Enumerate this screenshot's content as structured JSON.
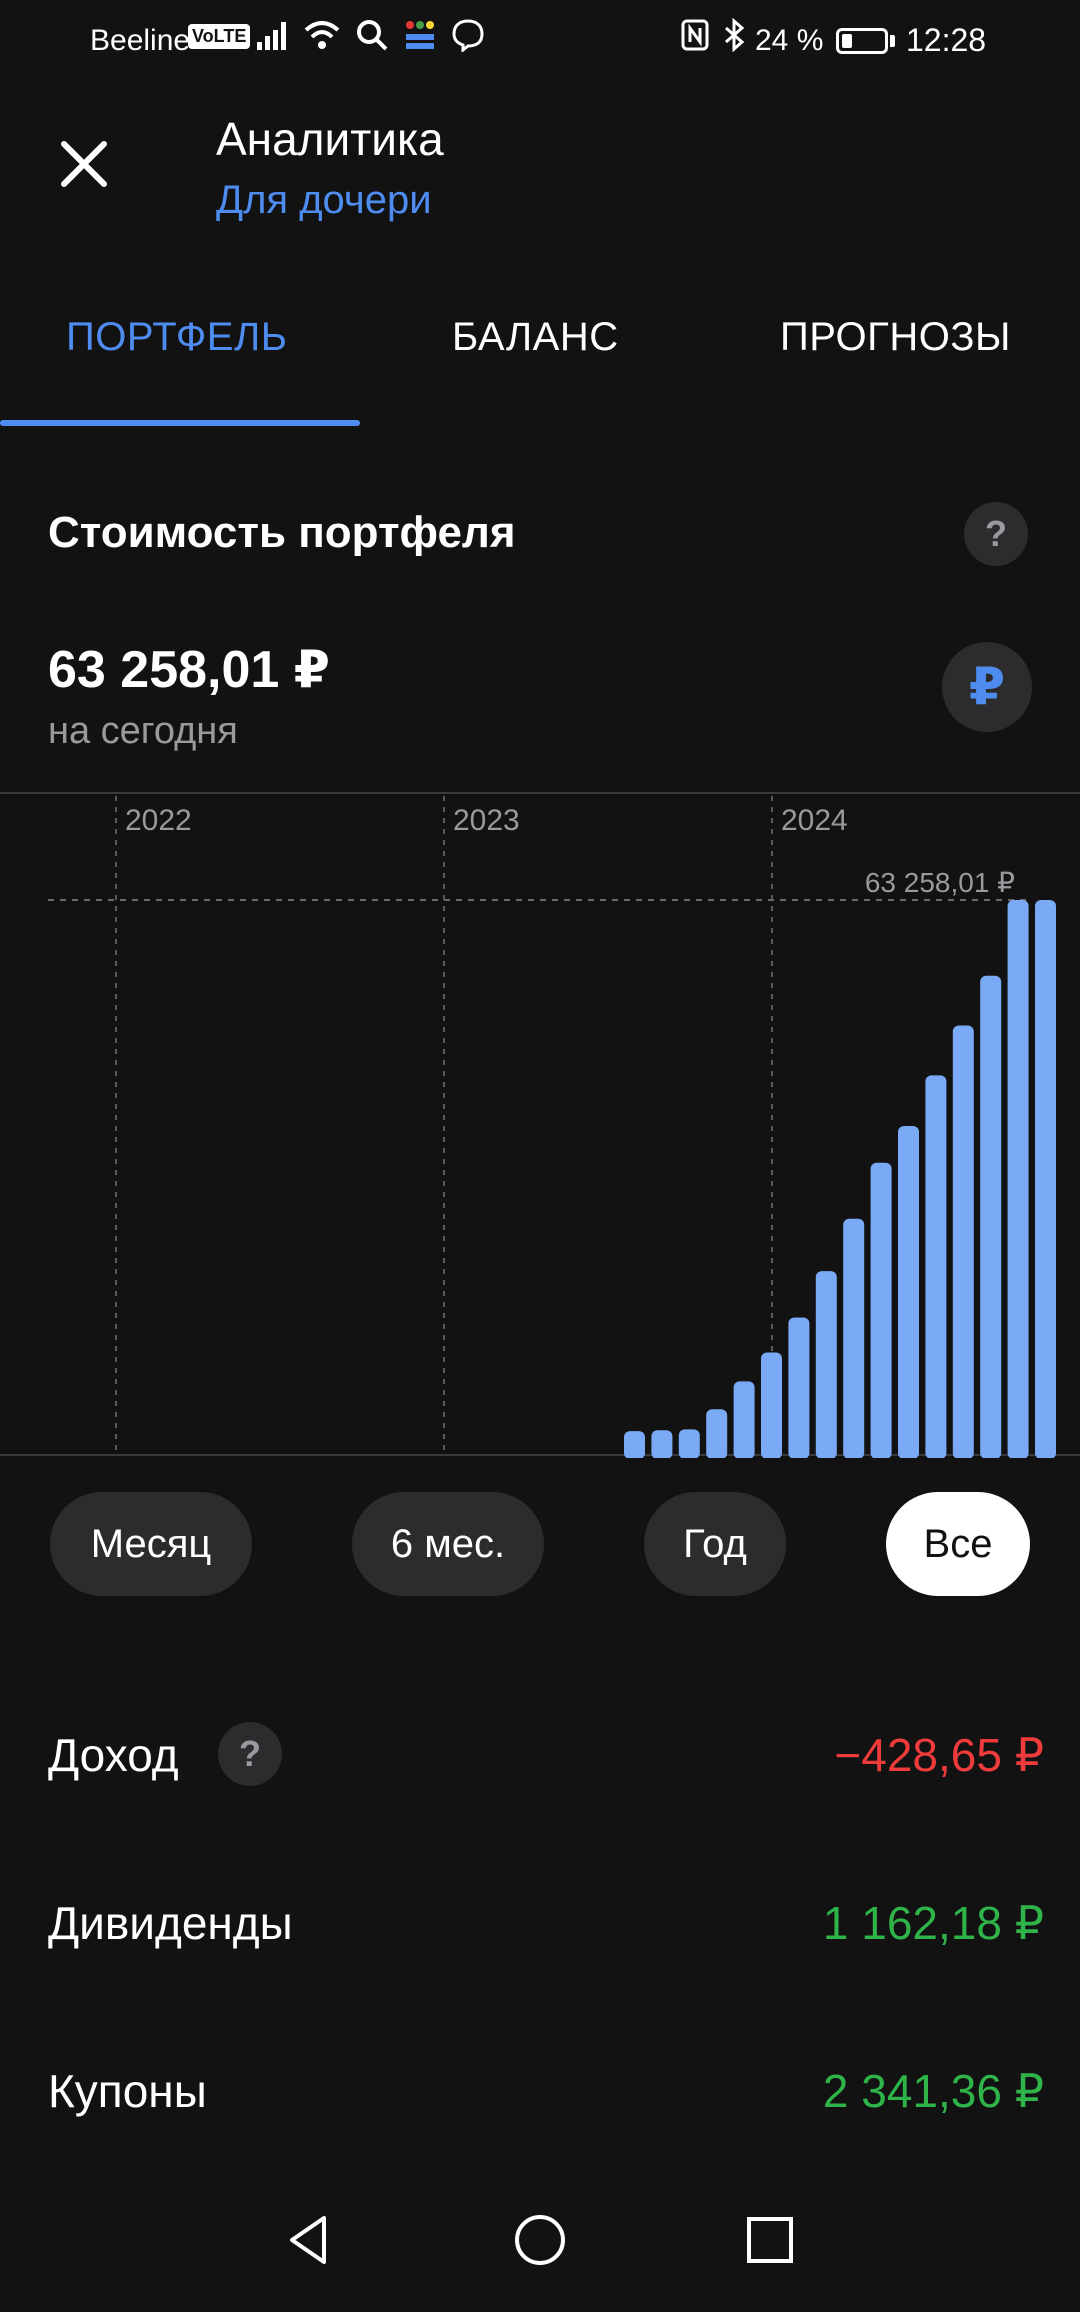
{
  "status_bar": {
    "carrier": "Beeline",
    "volte": "VoLTE",
    "battery": "24 %",
    "time": "12:28",
    "icons_left": [
      "signal-icon",
      "wifi-icon",
      "search-icon",
      "detmir-icon",
      "viber-icon"
    ],
    "icons_right": [
      "nfc-icon",
      "bluetooth-icon",
      "battery-icon"
    ]
  },
  "header": {
    "title": "Аналитика",
    "subtitle": "Для дочери",
    "close_icon": "close-icon"
  },
  "tabs": [
    {
      "label": "ПОРТФЕЛЬ",
      "active": true
    },
    {
      "label": "БАЛАНС",
      "active": false
    },
    {
      "label": "ПРОГНОЗЫ",
      "active": false
    }
  ],
  "portfolio": {
    "title": "Стоимость портфеля",
    "help": "?",
    "value": "63 258,01 ₽",
    "value_caption": "на сегодня",
    "currency_symbol": "₽"
  },
  "chart_data": {
    "type": "bar",
    "x_tick_labels": [
      "2022",
      "2023",
      "2024"
    ],
    "peak_label": "63 258,01 ₽",
    "values": [
      2500,
      2600,
      2700,
      5000,
      8200,
      11500,
      15500,
      20800,
      26800,
      33200,
      37400,
      43200,
      48900,
      54600,
      63258.01,
      63258.01
    ],
    "ylim": [
      0,
      63258.01
    ],
    "bar_color": "#7aaaf5",
    "grid": true
  },
  "periods": [
    {
      "label": "Месяц",
      "active": false
    },
    {
      "label": "6 мес.",
      "active": false
    },
    {
      "label": "Год",
      "active": false
    },
    {
      "label": "Все",
      "active": true
    }
  ],
  "metrics": [
    {
      "label": "Доход",
      "value": "−428,65 ₽",
      "color": "#ef3b3b",
      "has_help": true
    },
    {
      "label": "Дивиденды",
      "value": "1 162,18 ₽",
      "color": "#2fb44a"
    },
    {
      "label": "Купоны",
      "value": "2 341,36 ₽",
      "color": "#2fb44a"
    }
  ],
  "colors": {
    "background": "#121212",
    "accent": "#4e8cf0",
    "surface": "#2c2c2e",
    "negative": "#ef3b3b",
    "positive": "#2fb44a"
  }
}
